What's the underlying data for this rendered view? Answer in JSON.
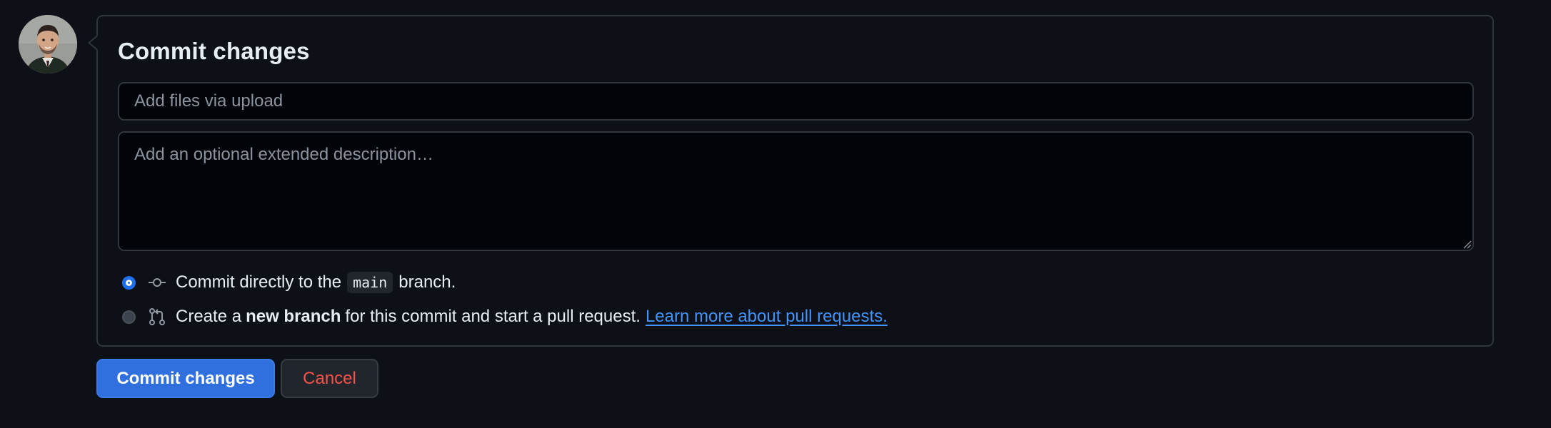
{
  "form": {
    "title": "Commit changes",
    "summary_placeholder": "Add files via upload",
    "summary_value": "",
    "description_placeholder": "Add an optional extended description…",
    "description_value": ""
  },
  "options": {
    "direct": {
      "prefix": "Commit directly to the",
      "branch": "main",
      "suffix": "branch.",
      "checked": true,
      "icon": "git-commit-icon"
    },
    "new_branch": {
      "prefix": "Create a",
      "bold": "new branch",
      "suffix": "for this commit and start a pull request.",
      "link": "Learn more about pull requests.",
      "checked": false,
      "icon": "git-pull-request-icon"
    }
  },
  "buttons": {
    "commit": "Commit changes",
    "cancel": "Cancel"
  },
  "colors": {
    "background": "#0d1117",
    "primary": "#2f6fde",
    "danger": "#f85149",
    "link": "#4493f8"
  }
}
